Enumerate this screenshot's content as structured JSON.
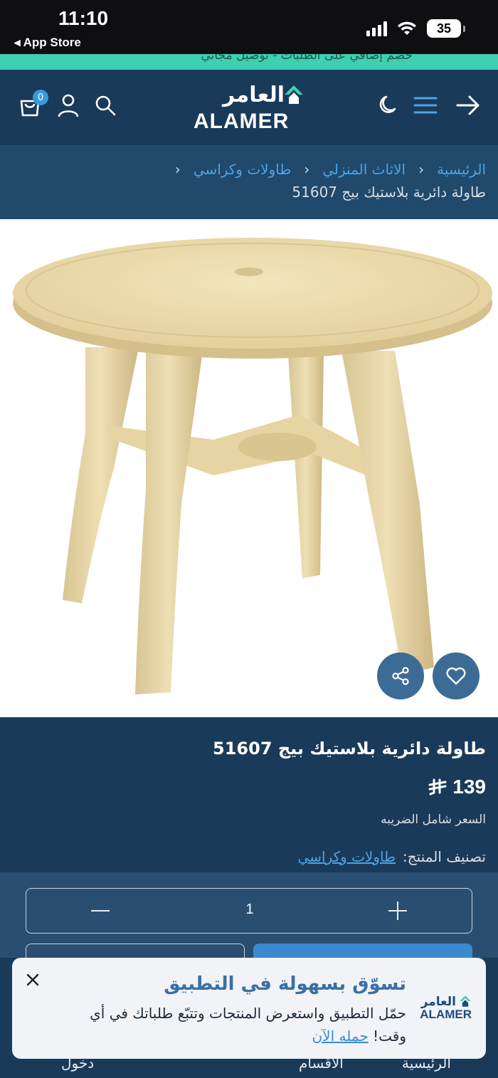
{
  "status_bar": {
    "time": "11:10",
    "back_label": "◂ App Store",
    "battery": "35"
  },
  "promo": {
    "text": "خصم إضافي على الطلبات - توصيل مجاني"
  },
  "header": {
    "cart_count": "0",
    "logo_ar": "العامر",
    "logo_en": "ALAMER"
  },
  "breadcrumb": {
    "items": [
      "الرئيسية",
      "الاثاث المنزلي",
      "طاولات وكراسي"
    ],
    "current": "طاولة دائرية بلاستيك بيج 51607"
  },
  "product": {
    "title": "طاولة دائرية بلاستيك بيج 51607",
    "price": "139",
    "currency_symbol": "⃁",
    "tax_note": "السعر شامل الضريبه",
    "category_label": "تصنيف المنتج:",
    "category_value": "طاولات وكراسي",
    "quantity": "1"
  },
  "bottom_nav": {
    "items": [
      "الرئيسية",
      "الأقسام",
      "دخول"
    ]
  },
  "app_banner": {
    "logo_ar": "العامر",
    "logo_en": "ALAMER",
    "title": "تسوّق بسهولة في التطبيق",
    "desc": "حمّل التطبيق واستعرض المنتجات وتتبّع طلباتك في أي وقت! حمله الآن",
    "link": "حمله الآن"
  },
  "colors": {
    "header_bg": "#1a3a5a",
    "accent": "#3fcfb2",
    "link": "#4ea3e2",
    "fab": "#3c6b96"
  }
}
